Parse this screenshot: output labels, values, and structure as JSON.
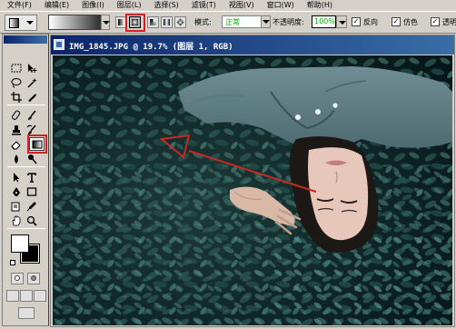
{
  "menu": [
    "文件(F)",
    "编辑(E)",
    "图像(I)",
    "图层(L)",
    "选择(S)",
    "滤镜(T)",
    "视图(V)",
    "窗口(W)",
    "帮助(H)"
  ],
  "options": {
    "mode_label": "模式:",
    "mode_value": "正常",
    "opacity_label": "不透明度:",
    "opacity_value": "100%",
    "reverse_label": "反向",
    "dither_label": "仿色",
    "transparency_label": "透明"
  },
  "document": {
    "title": "IMG_1845.JPG @ 19.7% (图层 1, RGB)"
  },
  "colors": {
    "highlight": "#d42020",
    "titlebar_start": "#0a246a",
    "titlebar_end": "#3a6ea5"
  },
  "icons": {
    "marquee": "marquee-icon",
    "move": "move-icon",
    "lasso": "lasso-icon",
    "magic_wand": "magic-wand-icon",
    "crop": "crop-icon",
    "slice": "slice-icon",
    "healing": "healing-brush-icon",
    "brush": "brush-icon",
    "stamp": "clone-stamp-icon",
    "history_brush": "history-brush-icon",
    "eraser": "eraser-icon",
    "gradient": "gradient-icon",
    "blur": "blur-icon",
    "dodge": "dodge-icon",
    "path_select": "path-selection-icon",
    "type": "type-icon",
    "pen": "pen-icon",
    "shape": "shape-icon",
    "notes": "notes-icon",
    "eyedropper": "eyedropper-icon",
    "hand": "hand-icon",
    "zoom": "zoom-icon"
  }
}
